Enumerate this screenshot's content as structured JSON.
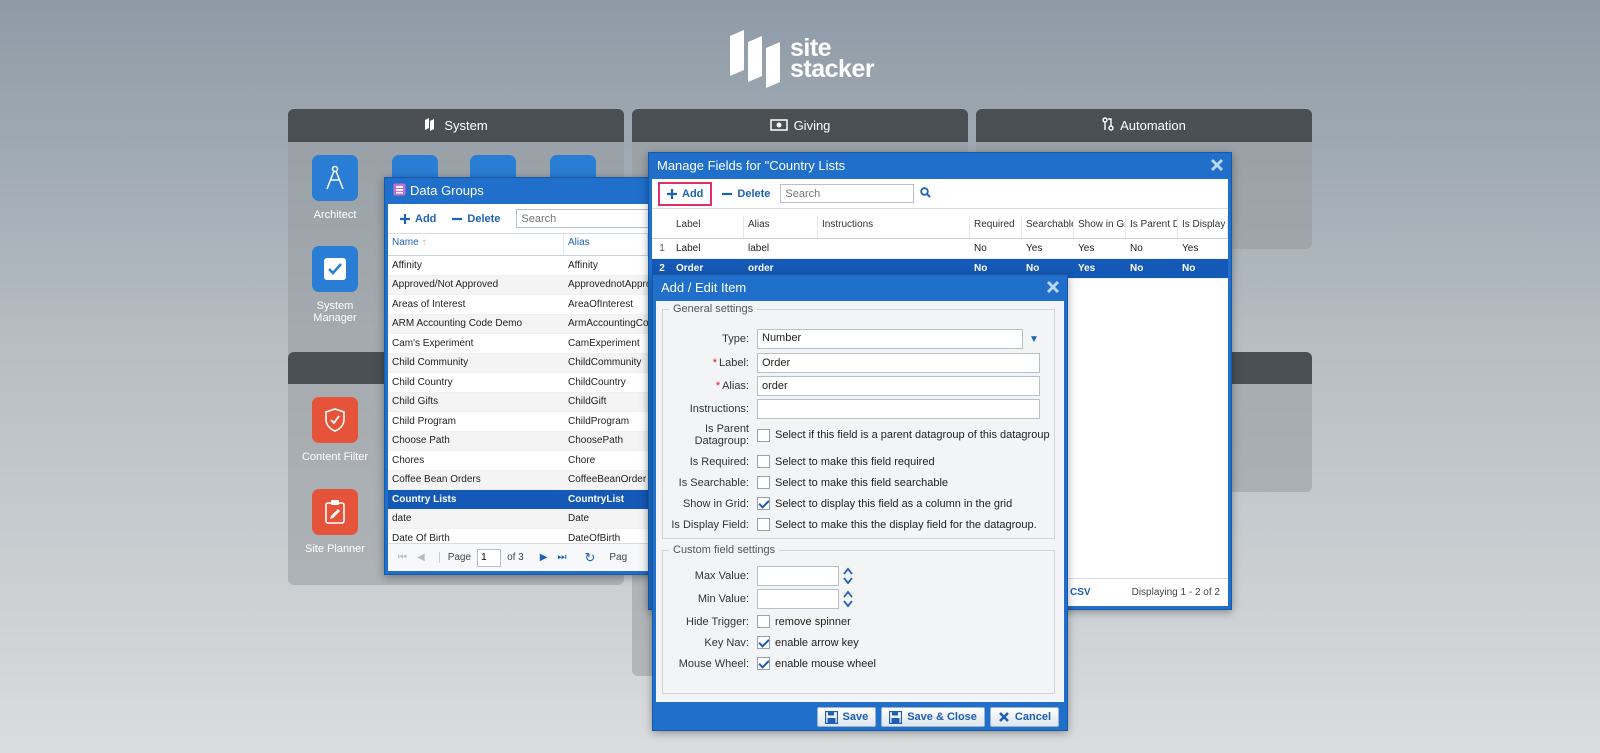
{
  "brand": {
    "line1": "site",
    "line2": "stacker"
  },
  "panels": {
    "system": {
      "title": "System"
    },
    "giving": {
      "title": "Giving"
    },
    "automation": {
      "title": "Automation"
    }
  },
  "tiles": {
    "architect": "Architect",
    "system_manager": "System Manager",
    "content_filter": "Content Filter",
    "site_planner": "Site Planner"
  },
  "data_groups": {
    "title": "Data Groups",
    "add_label": "Add",
    "delete_label": "Delete",
    "search_placeholder": "Search",
    "columns": [
      "Name",
      "Alias"
    ],
    "rows": [
      [
        "Affinity",
        "Affinity"
      ],
      [
        "Approved/Not Approved",
        "ApprovednotApproved"
      ],
      [
        "Areas of Interest",
        "AreaOfInterest"
      ],
      [
        "ARM Accounting Code Demo",
        "ArmAccountingCode"
      ],
      [
        "Cam's Experiment",
        "CamExperiment"
      ],
      [
        "Child Community",
        "ChildCommunity"
      ],
      [
        "Child Country",
        "ChildCountry"
      ],
      [
        "Child Gifts",
        "ChildGift"
      ],
      [
        "Child Program",
        "ChildProgram"
      ],
      [
        "Choose Path",
        "ChoosePath"
      ],
      [
        "Chores",
        "Chore"
      ],
      [
        "Coffee Bean Orders",
        "CoffeeBeanOrder"
      ],
      [
        "Country Lists",
        "CountryList"
      ],
      [
        "date",
        "Date"
      ],
      [
        "Date Of Birth",
        "DateOfBirth"
      ]
    ],
    "selected_index": 12,
    "pager": {
      "page_label": "Page",
      "page_value": "1",
      "of_label": "of 3",
      "trailing": "Pag"
    }
  },
  "manage_fields": {
    "title": "Manage Fields for \"Country Lists",
    "add_label": "Add",
    "delete_label": "Delete",
    "search_placeholder": "Search",
    "columns": [
      "Label",
      "Alias",
      "Instructions",
      "Required",
      "Searchable",
      "Show in Gr",
      "Is Parent D",
      "Is Display"
    ],
    "rows": [
      [
        "1",
        "Label",
        "label",
        "",
        "No",
        "Yes",
        "Yes",
        "No",
        "Yes"
      ],
      [
        "2",
        "Order",
        "order",
        "",
        "No",
        "No",
        "Yes",
        "No",
        "No"
      ]
    ],
    "csv_label": "CSV",
    "displaying": "Displaying 1 - 2 of 2"
  },
  "edit_item": {
    "title": "Add / Edit Item",
    "general_legend": "General settings",
    "type": {
      "label": "Type:",
      "value": "Number"
    },
    "label_field": {
      "label": "Label:",
      "value": "Order"
    },
    "alias_field": {
      "label": "Alias:",
      "value": "order"
    },
    "instructions": {
      "label": "Instructions:",
      "value": ""
    },
    "is_parent": {
      "label": "Is Parent Datagroup:",
      "text": "Select if this field is a parent datagroup of this datagroup",
      "checked": false
    },
    "is_required": {
      "label": "Is Required:",
      "text": "Select to make this field required",
      "checked": false
    },
    "is_searchable": {
      "label": "Is Searchable:",
      "text": "Select to make this field searchable",
      "checked": false
    },
    "show_in_grid": {
      "label": "Show in Grid:",
      "text": "Select to display this field as a column in the grid",
      "checked": true
    },
    "is_display": {
      "label": "Is Display Field:",
      "text": "Select to make this the display field for the datagroup.",
      "checked": false
    },
    "custom_legend": "Custom field settings",
    "max_value": {
      "label": "Max Value:",
      "value": ""
    },
    "min_value": {
      "label": "Min Value:",
      "value": ""
    },
    "hide_trigger": {
      "label": "Hide Trigger:",
      "text": "remove spinner",
      "checked": false
    },
    "key_nav": {
      "label": "Key Nav:",
      "text": "enable arrow key",
      "checked": true
    },
    "mouse_wheel": {
      "label": "Mouse Wheel:",
      "text": "enable mouse wheel",
      "checked": true
    },
    "save_label": "Save",
    "save_close_label": "Save & Close",
    "cancel_label": "Cancel"
  }
}
